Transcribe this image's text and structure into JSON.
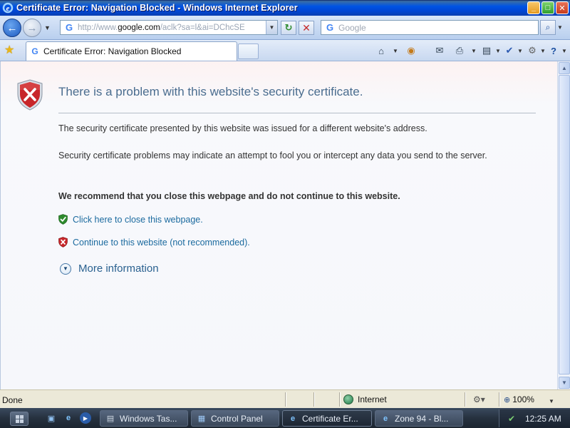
{
  "window": {
    "title": "Certificate Error: Navigation Blocked - Windows Internet Explorer",
    "minimize": "_",
    "maximize": "□",
    "close": "✕"
  },
  "navbar": {
    "address_url_prefix": "http://www.",
    "address_url_domain": "google.com",
    "address_url_suffix": "/aclk?sa=l&ai=DChcSE",
    "search_placeholder": "Google",
    "search_button": "⌕"
  },
  "tabs": [
    {
      "label": "Certificate Error: Navigation Blocked",
      "active": true
    }
  ],
  "page": {
    "heading": "There is a problem with this website's security certificate.",
    "paragraph_1": "The security certificate presented by this website was issued for a different website's address.",
    "paragraph_2": "Security certificate problems may indicate an attempt to fool you or intercept any data you send to the server.",
    "recommendation": "We recommend that you close this webpage and do not continue to this website.",
    "close_link": "Click here to close this webpage.",
    "continue_link": "Continue to this website (not recommended).",
    "more_info": "More information"
  },
  "statusbar": {
    "status": "Done",
    "zone": "Internet",
    "zoom": "100%"
  },
  "taskbar": {
    "tasks": [
      {
        "label": "Windows Tas...",
        "icon": "task-manager-icon",
        "active": false
      },
      {
        "label": "Control Panel",
        "icon": "control-panel-icon",
        "active": false
      },
      {
        "label": "Certificate Er...",
        "icon": "ie-icon",
        "active": true
      },
      {
        "label": "Zone 94 - Bl...",
        "icon": "ie-icon",
        "active": false
      }
    ],
    "clock": "12:25 AM"
  },
  "colors": {
    "title_bar": "#0054e3",
    "heading": "#4a6d8f",
    "link": "#1b6a9f",
    "error_red": "#c62a2a",
    "safe_green": "#2d8a2d"
  }
}
